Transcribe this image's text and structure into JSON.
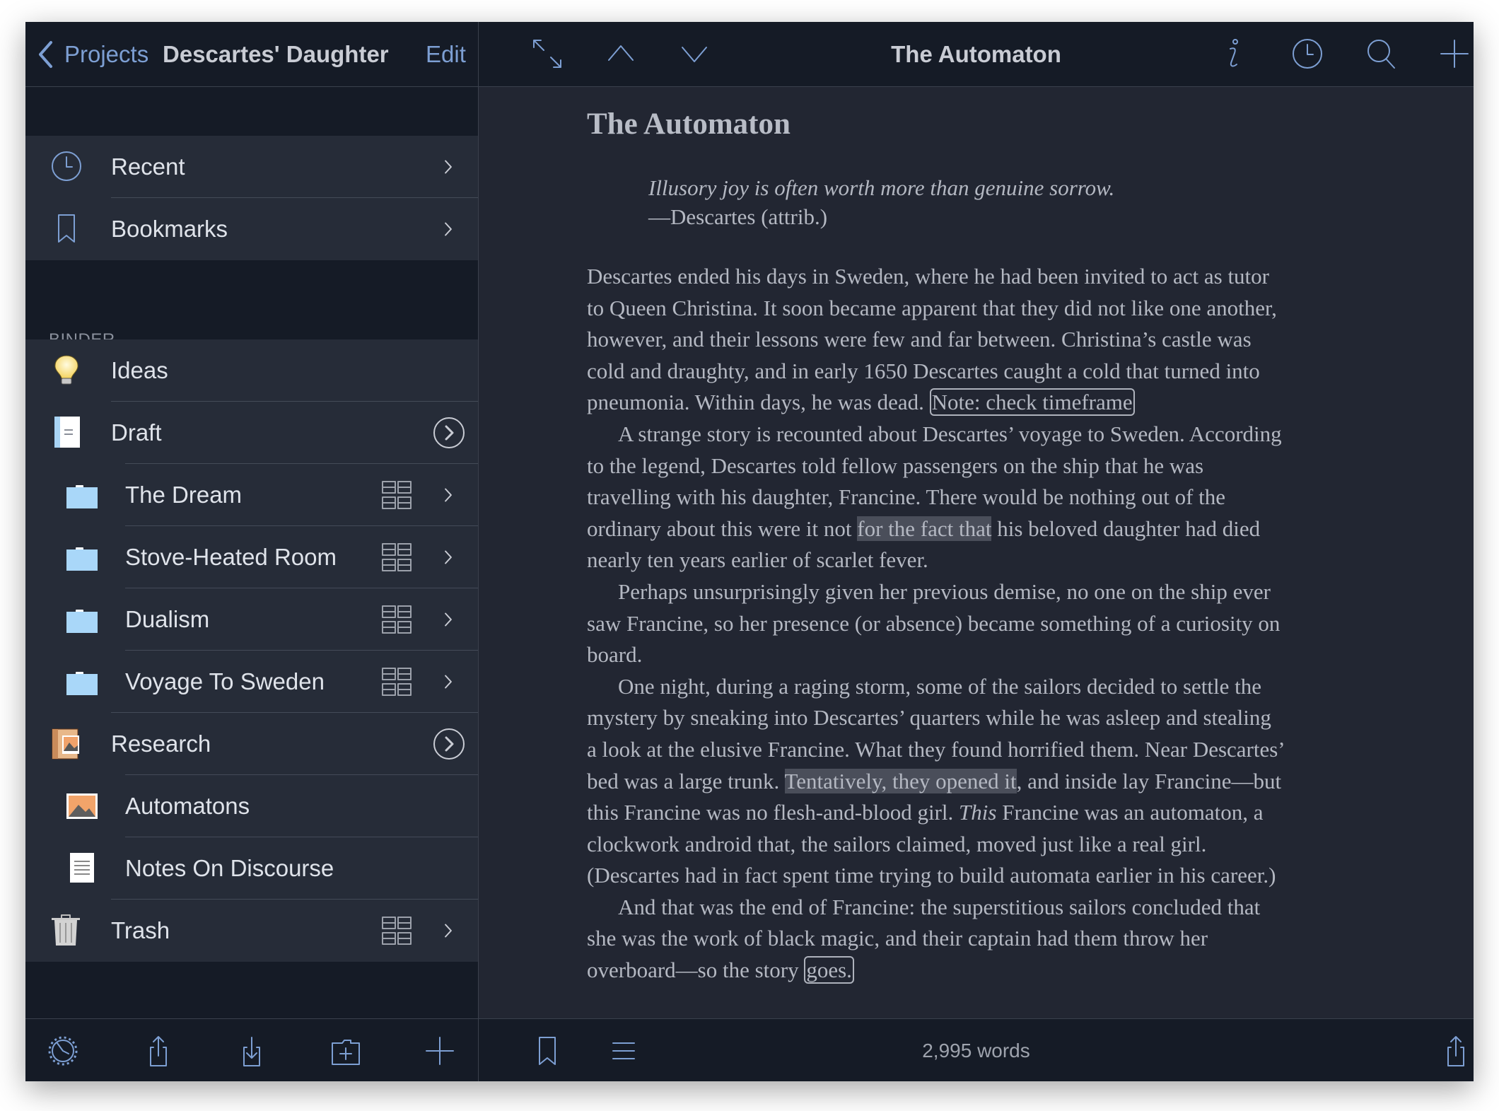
{
  "sidebar": {
    "back_label": "Projects",
    "project_title": "Descartes' Daughter",
    "edit_label": "Edit",
    "binder_heading": "BINDER",
    "nav_items": [
      {
        "label": "Recent",
        "icon": "clock-icon",
        "accessory": "chevron"
      },
      {
        "label": "Bookmarks",
        "icon": "bookmark-icon",
        "accessory": "chevron"
      }
    ],
    "binder_items": [
      {
        "label": "Ideas",
        "icon": "lightbulb-icon",
        "level": 0,
        "accessory": "none"
      },
      {
        "label": "Draft",
        "icon": "draft-icon",
        "level": 0,
        "accessory": "circle-chevron"
      },
      {
        "label": "The Dream",
        "icon": "folder-icon",
        "level": 1,
        "accessory": "grid-chevron"
      },
      {
        "label": "Stove-Heated Room",
        "icon": "folder-icon",
        "level": 1,
        "accessory": "grid-chevron"
      },
      {
        "label": "Dualism",
        "icon": "folder-icon",
        "level": 1,
        "accessory": "grid-chevron"
      },
      {
        "label": "Voyage To Sweden",
        "icon": "folder-icon",
        "level": 1,
        "accessory": "grid-chevron"
      },
      {
        "label": "Research",
        "icon": "research-icon",
        "level": 0,
        "accessory": "circle-chevron"
      },
      {
        "label": "Automatons",
        "icon": "image-icon",
        "level": 1,
        "accessory": "none"
      },
      {
        "label": "Notes On Discourse",
        "icon": "text-document-icon",
        "level": 1,
        "accessory": "none"
      },
      {
        "label": "Trash",
        "icon": "trash-icon",
        "level": 0,
        "accessory": "grid-chevron"
      }
    ],
    "toolbar_icons": [
      "gear-icon",
      "share-icon",
      "import-icon",
      "add-folder-icon",
      "plus-icon"
    ]
  },
  "editor": {
    "header_title": "The Automaton",
    "header_icons_left": [
      "expand-icon",
      "chevron-up-icon",
      "chevron-down-icon"
    ],
    "header_icons_right": [
      "info-icon",
      "clock-icon",
      "search-icon",
      "plus-icon"
    ],
    "doc_title": "The Automaton",
    "epigraph": "Illusory joy is often worth more than genuine sorrow.",
    "attribution": "—Descartes (attrib.)",
    "lines": [
      {
        "indent": false,
        "segs": [
          {
            "t": "Descartes ended his days in Sweden, where he had been invited to act as tutor"
          }
        ]
      },
      {
        "indent": false,
        "segs": [
          {
            "t": "to Queen Christina. It soon became apparent that they did not like one another,"
          }
        ]
      },
      {
        "indent": false,
        "segs": [
          {
            "t": "however, and their lessons were few and far between. Christina’s castle was"
          }
        ]
      },
      {
        "indent": false,
        "segs": [
          {
            "t": "cold and draughty, and in early 1650 Descartes caught a cold that turned into"
          }
        ]
      },
      {
        "indent": false,
        "segs": [
          {
            "t": "pneumonia. Within days, he was dead. "
          },
          {
            "t": "Note: check timeframe",
            "style": "note"
          }
        ]
      },
      {
        "indent": true,
        "segs": [
          {
            "t": "A strange story is recounted about Descartes’ voyage to Sweden. According"
          }
        ]
      },
      {
        "indent": false,
        "segs": [
          {
            "t": "to the legend, Descartes told fellow passengers on the ship that he was"
          }
        ]
      },
      {
        "indent": false,
        "segs": [
          {
            "t": "travelling with his daughter, Francine. There would be nothing out of the"
          }
        ]
      },
      {
        "indent": false,
        "segs": [
          {
            "t": "ordinary about this were it not "
          },
          {
            "t": "for the fact that",
            "style": "highlight"
          },
          {
            "t": " his beloved daughter had died"
          }
        ]
      },
      {
        "indent": false,
        "segs": [
          {
            "t": "nearly ten years earlier of scarlet fever."
          }
        ]
      },
      {
        "indent": true,
        "segs": [
          {
            "t": "Perhaps unsurprisingly given her previous demise, no one on the ship ever"
          }
        ]
      },
      {
        "indent": false,
        "segs": [
          {
            "t": "saw Francine, so her presence (or absence) became something of a curiosity on"
          }
        ]
      },
      {
        "indent": false,
        "segs": [
          {
            "t": "board."
          }
        ]
      },
      {
        "indent": true,
        "segs": [
          {
            "t": "One night, during a raging storm, some of the sailors decided to settle the"
          }
        ]
      },
      {
        "indent": false,
        "segs": [
          {
            "t": "mystery by sneaking into Descartes’ quarters while he was asleep and stealing"
          }
        ]
      },
      {
        "indent": false,
        "segs": [
          {
            "t": "a look at the elusive Francine. What they found horrified them. Near Descartes’"
          }
        ]
      },
      {
        "indent": false,
        "segs": [
          {
            "t": "bed was a large trunk. "
          },
          {
            "t": "Tentatively, they opened it",
            "style": "highlight"
          },
          {
            "t": ", and inside lay Francine—but"
          }
        ]
      },
      {
        "indent": false,
        "segs": [
          {
            "t": "this Francine was no flesh-and-blood girl. "
          },
          {
            "t": "This",
            "style": "italic"
          },
          {
            "t": " Francine was an automaton, a"
          }
        ]
      },
      {
        "indent": false,
        "segs": [
          {
            "t": "clockwork android that, the sailors claimed, moved just like a real girl."
          }
        ]
      },
      {
        "indent": false,
        "segs": [
          {
            "t": "(Descartes had in fact spent time trying to build automata earlier in his career.)"
          }
        ]
      },
      {
        "indent": true,
        "segs": [
          {
            "t": "And that was the end of Francine: the superstitious sailors concluded that"
          }
        ]
      },
      {
        "indent": false,
        "segs": [
          {
            "t": "she was the work of black magic, and their captain had them throw her"
          }
        ]
      },
      {
        "indent": false,
        "segs": [
          {
            "t": "overboard—so the story "
          },
          {
            "t": "goes.",
            "style": "note"
          }
        ]
      }
    ],
    "word_count": "2,995 words",
    "toolbar_icons_left": [
      "bookmark-icon",
      "list-icon"
    ],
    "toolbar_icons_right": [
      "share-icon"
    ]
  },
  "colors": {
    "accent": "#7d9fd3",
    "bar_bg": "#151b26",
    "row_bg": "#262c38",
    "editor_bg": "#222632",
    "highlight": "#4a4e5a"
  }
}
